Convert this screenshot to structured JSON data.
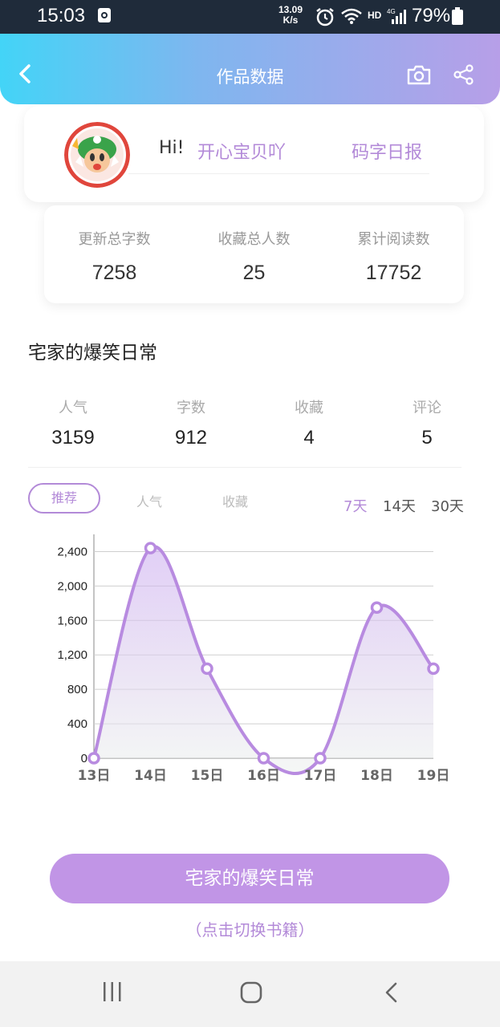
{
  "status_bar": {
    "time": "15:03",
    "network_speed_value": "13.09",
    "network_speed_unit": "K/s",
    "hd_label": "HD",
    "battery": "79%"
  },
  "header": {
    "title": "作品数据",
    "icons": [
      "back-icon",
      "camera-icon",
      "share-icon"
    ]
  },
  "profile": {
    "greeting": "Hi!",
    "username": "开心宝贝吖",
    "daily_report": "码字日报"
  },
  "summary": [
    {
      "label": "更新总字数",
      "value": "7258"
    },
    {
      "label": "收藏总人数",
      "value": "25"
    },
    {
      "label": "累计阅读数",
      "value": "17752"
    }
  ],
  "book": {
    "title": "宅家的爆笑日常",
    "stats": [
      {
        "label": "人气",
        "value": "3159"
      },
      {
        "label": "字数",
        "value": "912"
      },
      {
        "label": "收藏",
        "value": "4"
      },
      {
        "label": "评论",
        "value": "5"
      }
    ]
  },
  "tabs": [
    "推荐",
    "人气",
    "收藏"
  ],
  "ranges": [
    "7天",
    "14天",
    "30天"
  ],
  "active_range": "7天",
  "chart_data": {
    "type": "area",
    "categories": [
      "13日",
      "14日",
      "15日",
      "16日",
      "17日",
      "18日",
      "19日"
    ],
    "values": [
      0,
      2440,
      1040,
      0,
      0,
      1750,
      1040
    ],
    "yticks": [
      "0",
      "400",
      "800",
      "1,200",
      "1,600",
      "2,000",
      "2,400"
    ],
    "ylim": [
      0,
      2600
    ],
    "grid": true,
    "color": "#b88be0"
  },
  "switch_button": {
    "label": "宅家的爆笑日常",
    "hint": "（点击切换书籍）"
  },
  "accent_color": "#b38ad8"
}
